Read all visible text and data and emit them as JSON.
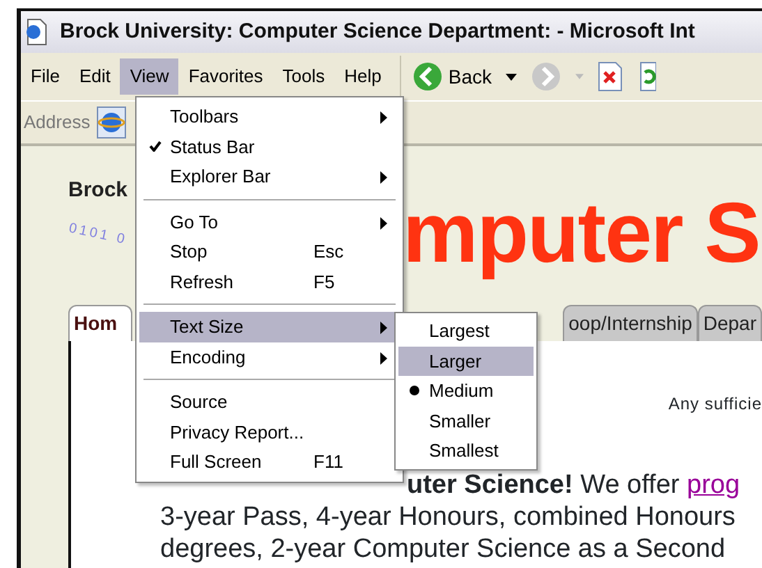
{
  "window": {
    "title": "Brock University: Computer Science Department: - Microsoft Int"
  },
  "menu_bar": [
    {
      "label": "File",
      "selected": false
    },
    {
      "label": "Edit",
      "selected": false
    },
    {
      "label": "View",
      "selected": true
    },
    {
      "label": "Favorites",
      "selected": false
    },
    {
      "label": "Tools",
      "selected": false
    },
    {
      "label": "Help",
      "selected": false
    }
  ],
  "toolbar": {
    "back_label": "Back"
  },
  "address_bar": {
    "label": "Address"
  },
  "page": {
    "site_name": "Brock",
    "binary_mark": "0101 0",
    "banner": "mputer S",
    "tabs": [
      {
        "label": "Hom",
        "selected": true
      },
      {
        "label": "oop/Internship",
        "selected": false
      },
      {
        "label": "Depar",
        "selected": false
      }
    ],
    "notice": "Any sufficie",
    "intro": "**uter Science!** We offer ",
    "intro_link": "prog",
    "lines": [
      "3-year Pass, 4-year Honours, combined Honours",
      "degrees, 2-year Computer Science as a Second"
    ]
  },
  "view_menu": [
    {
      "kind": "item",
      "label": "Toolbars",
      "checked": false,
      "submenu": true,
      "highlighted": false
    },
    {
      "kind": "item",
      "label": "Status Bar",
      "checked": true,
      "submenu": false,
      "highlighted": false
    },
    {
      "kind": "item",
      "label": "Explorer Bar",
      "checked": false,
      "submenu": true,
      "highlighted": false
    },
    {
      "kind": "separator"
    },
    {
      "kind": "item",
      "label": "Go To",
      "checked": false,
      "submenu": true,
      "highlighted": false
    },
    {
      "kind": "item",
      "label": "Stop",
      "shortcut": "Esc",
      "checked": false,
      "submenu": false,
      "highlighted": false
    },
    {
      "kind": "item",
      "label": "Refresh",
      "shortcut": "F5",
      "checked": false,
      "submenu": false,
      "highlighted": false
    },
    {
      "kind": "separator"
    },
    {
      "kind": "item",
      "label": "Text Size",
      "checked": false,
      "submenu": true,
      "highlighted": true
    },
    {
      "kind": "item",
      "label": "Encoding",
      "checked": false,
      "submenu": true,
      "highlighted": false
    },
    {
      "kind": "separator"
    },
    {
      "kind": "item",
      "label": "Source",
      "checked": false,
      "submenu": false,
      "highlighted": false
    },
    {
      "kind": "item",
      "label": "Privacy Report...",
      "checked": false,
      "submenu": false,
      "highlighted": false
    },
    {
      "kind": "item",
      "label": "Full Screen",
      "shortcut": "F11",
      "checked": false,
      "submenu": false,
      "highlighted": false
    }
  ],
  "text_size_menu": [
    {
      "label": "Largest",
      "selected": false,
      "highlighted": false
    },
    {
      "label": "Larger",
      "selected": false,
      "highlighted": true
    },
    {
      "label": "Medium",
      "selected": true,
      "highlighted": false
    },
    {
      "label": "Smaller",
      "selected": false,
      "highlighted": false
    },
    {
      "label": "Smallest",
      "selected": false,
      "highlighted": false
    }
  ]
}
